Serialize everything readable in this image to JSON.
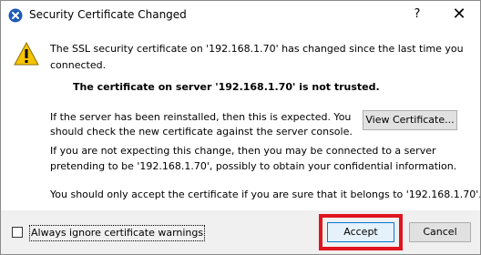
{
  "window": {
    "title": "Security Certificate Changed",
    "help_label": "?",
    "close_label": "✕"
  },
  "message": {
    "line1": "The SSL security certificate on '192.168.1.70' has changed since the last time you",
    "line2": "connected.",
    "trust_warning": "The certificate on server '192.168.1.70' is not trusted.",
    "reinstall_line1": "If the server has been reinstalled, then this is expected.  You",
    "reinstall_line2": "should check the new certificate against the server console.",
    "expect_line1": "If you are not expecting this change, then you may be connected to a server",
    "expect_line2": "pretending to be '192.168.1.70', possibly to obtain your confidential information.",
    "accept_only": "You should only accept the certificate if you are sure that it belongs to '192.168.1.70'."
  },
  "buttons": {
    "view_certificate": "View Certificate...",
    "accept": "Accept",
    "cancel": "Cancel"
  },
  "options": {
    "ignore_warnings_label": "Always ignore certificate warnings",
    "ignore_warnings_checked": false
  },
  "icons": {
    "app": "shield-x-icon",
    "warning": "warning-icon"
  },
  "colors": {
    "highlight": "#e0141e",
    "app_icon": "#1e5bb5",
    "warning": "#f5c400"
  }
}
